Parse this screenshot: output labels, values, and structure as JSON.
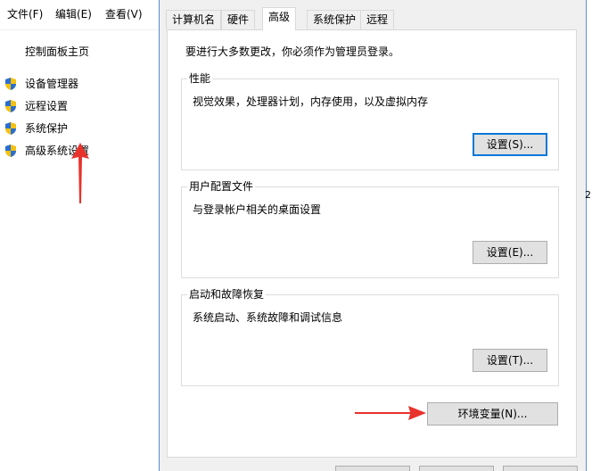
{
  "left_window": {
    "menu": [
      "文件(F)",
      "编辑(E)",
      "查看(V)"
    ],
    "home_link": "控制面板主页",
    "side_items": [
      "设备管理器",
      "远程设置",
      "系统保护",
      "高级系统设置"
    ]
  },
  "dialog": {
    "tabs": [
      "计算机名",
      "硬件",
      "高级",
      "系统保护",
      "远程"
    ],
    "active_tab": "高级",
    "admin_notice": "要进行大多数更改，你必须作为管理员登录。",
    "performance": {
      "title": "性能",
      "description": "视觉效果，处理器计划，内存使用，以及虚拟内存",
      "button": "设置(S)..."
    },
    "user_profiles": {
      "title": "用户配置文件",
      "description": "与登录帐户相关的桌面设置",
      "button": "设置(E)..."
    },
    "startup_recovery": {
      "title": "启动和故障恢复",
      "description": "系统启动、系统故障和调试信息",
      "button": "设置(T)..."
    },
    "env_button": "环境变量(N)..."
  },
  "right_fragment": "2",
  "colors": {
    "annotation_arrow": "#e8322c",
    "focus_border": "#0078d7",
    "window_border": "#5a8dd0"
  },
  "icons": {
    "side_item": "uac-shield-icon"
  }
}
